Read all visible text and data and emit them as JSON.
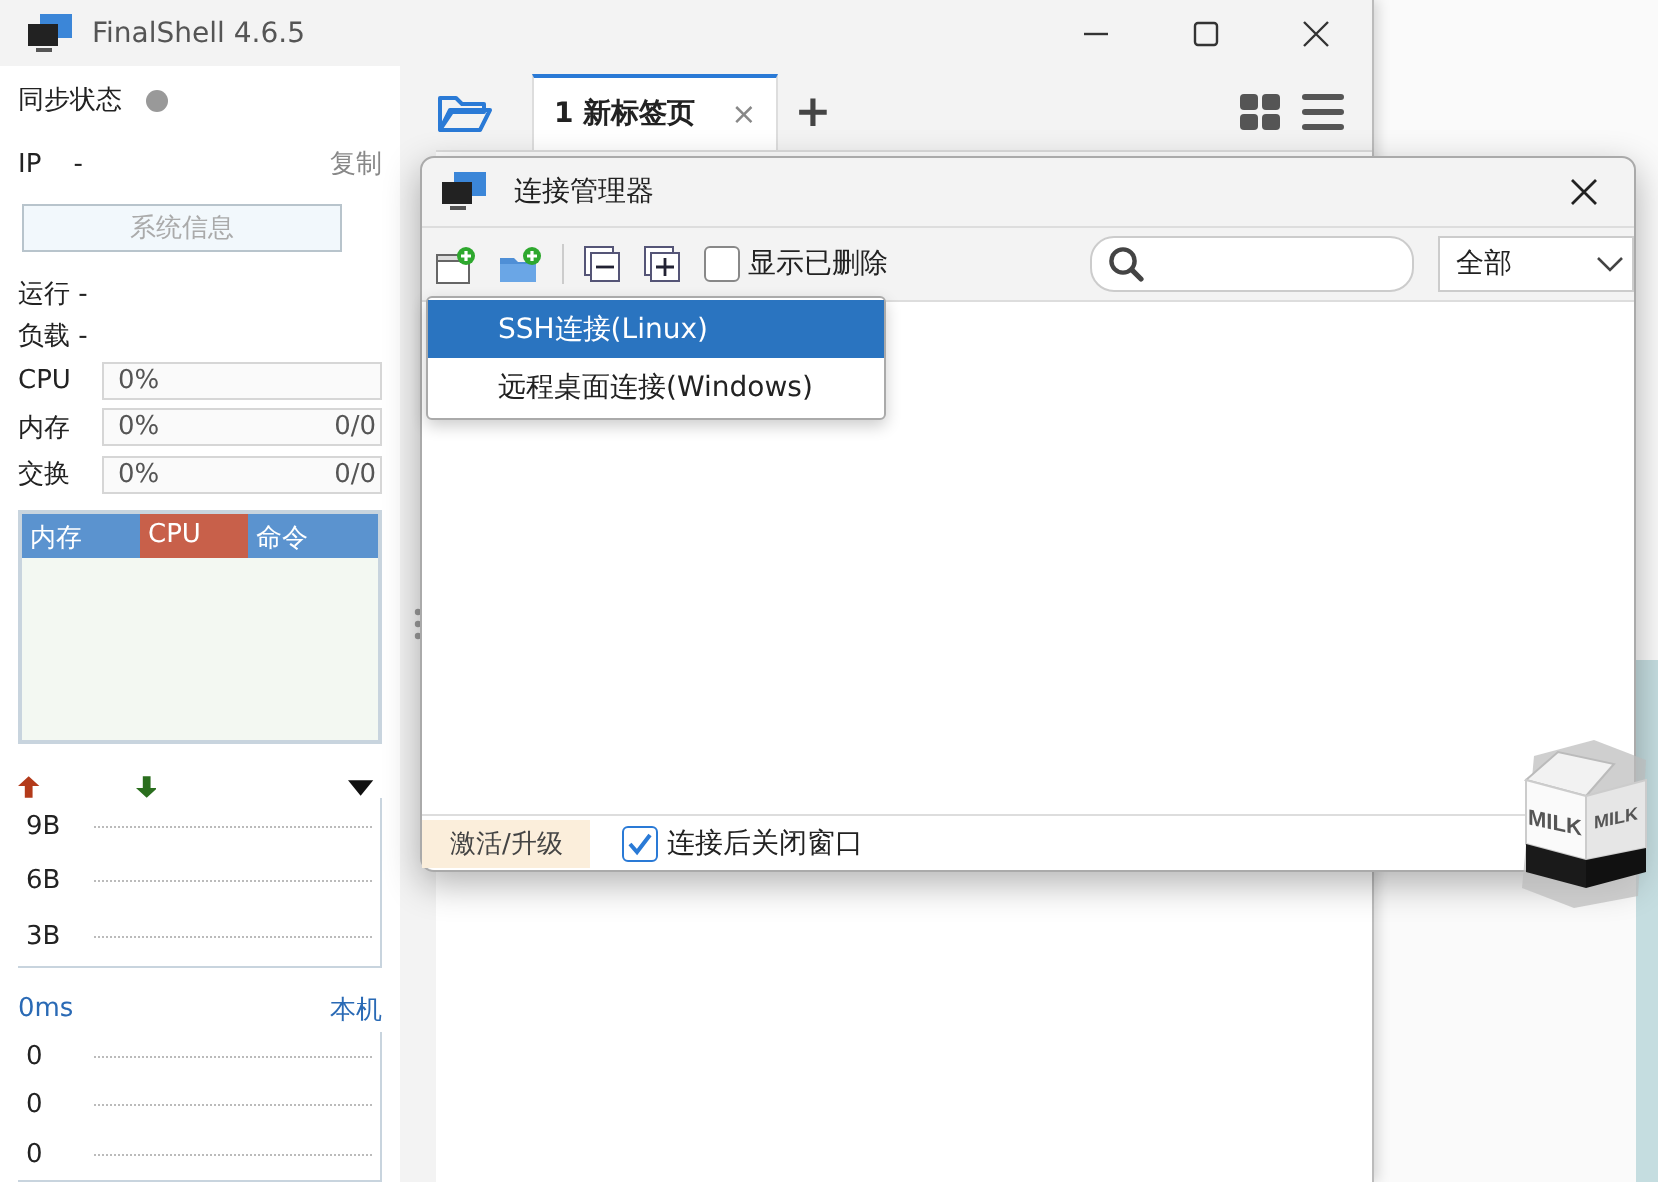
{
  "window": {
    "title": "FinalShell 4.6.5"
  },
  "sidebar": {
    "sync_label": "同步状态",
    "ip_label": "IP",
    "ip_value": "-",
    "copy_link": "复制",
    "sysinfo_button": "系统信息",
    "stats": [
      {
        "text": "运行 -"
      },
      {
        "text": "负载 -"
      }
    ],
    "meters": [
      {
        "label": "CPU",
        "percent": "0%",
        "level": 0
      },
      {
        "label": "内存",
        "percent": "0%",
        "detail": "0/0",
        "level": 0
      },
      {
        "label": "交换",
        "percent": "0%",
        "detail": "0/0",
        "level": 0
      }
    ],
    "process_columns": [
      {
        "label": "内存",
        "selected": false
      },
      {
        "label": "CPU",
        "selected": true
      },
      {
        "label": "命令",
        "selected": false
      }
    ],
    "net_ticks": [
      "9B",
      "6B",
      "3B"
    ],
    "ping_value": "0ms",
    "ping_target": "本机",
    "ping_ticks": [
      "0",
      "0",
      "0"
    ]
  },
  "tabs": [
    {
      "label": "1 新标签页",
      "close": "×",
      "selected": true
    }
  ],
  "add_tab": "+",
  "dialog": {
    "title": "连接管理器",
    "show_deleted": {
      "label": "显示已删除",
      "checked": false
    },
    "filter": "全部",
    "menu": [
      {
        "label": "SSH连接(Linux)",
        "selected": true
      },
      {
        "label": "远程桌面连接(Windows)",
        "selected": false
      }
    ],
    "activate_button": "激活/升级",
    "close_after": {
      "label": "连接后关闭窗口",
      "checked": true
    }
  },
  "desktop_pet": {
    "labels": [
      "MILK",
      "MILK"
    ]
  }
}
